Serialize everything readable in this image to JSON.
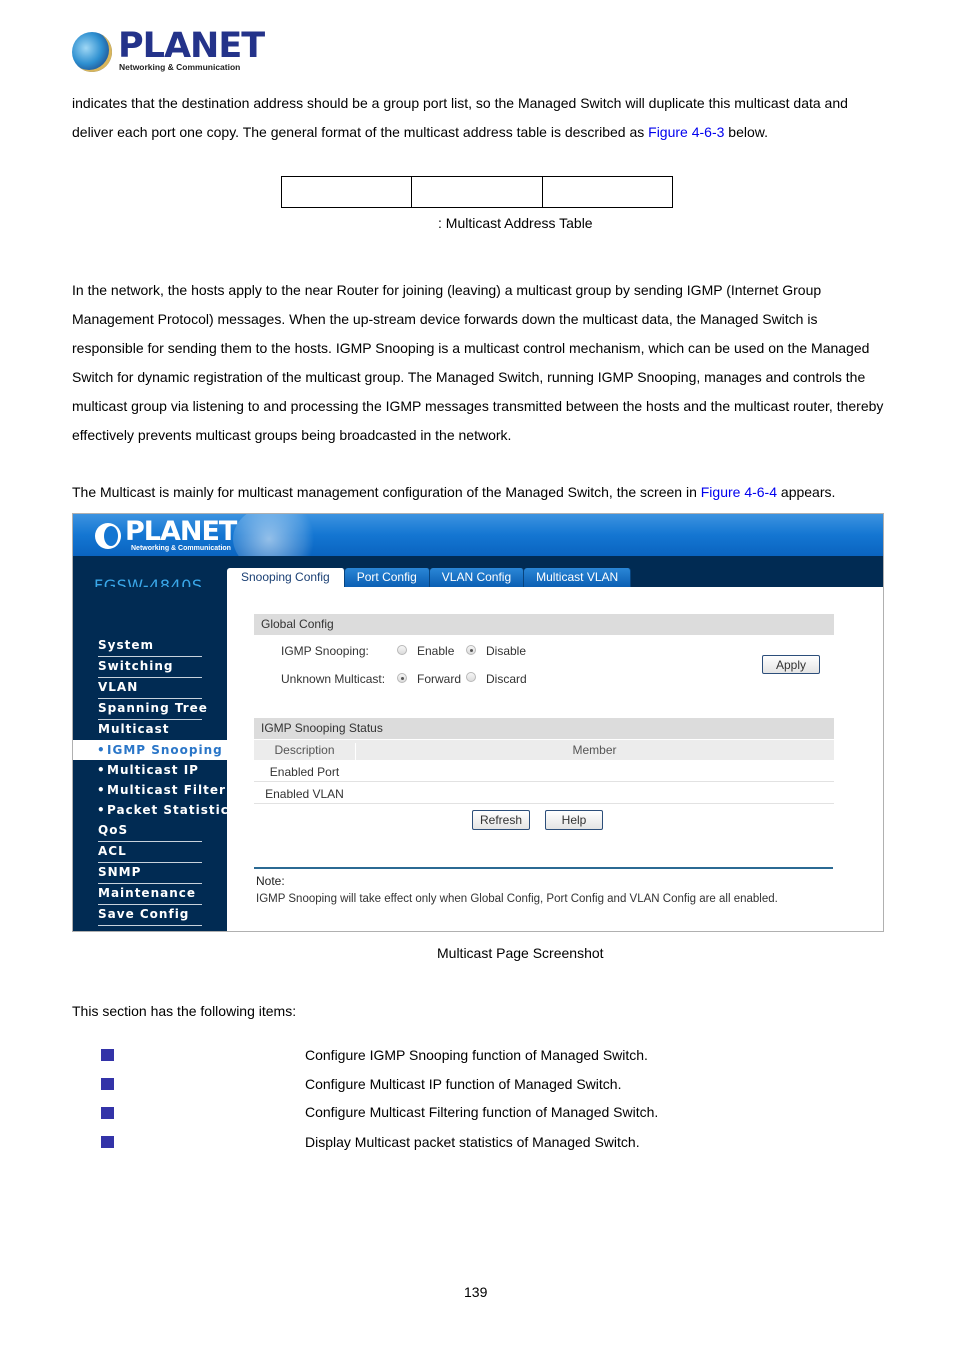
{
  "header_logo": {
    "brand": "PLANET",
    "tagline": "Networking & Communication",
    "icon": "planet-globe-logo"
  },
  "intro": {
    "line1": "indicates that the destination address should be a group port list, so the Managed Switch will duplicate this multicast data and",
    "line2_pre": "deliver each port one copy. The general format of the multicast address table is described as ",
    "line2_link": "Figure 4-6-3",
    "line2_post": " below."
  },
  "address_table": {
    "columns": [
      "",
      "",
      ""
    ],
    "caption": ": Multicast Address Table"
  },
  "igmp_paragraph": [
    "In the network, the hosts apply to the near Router for joining (leaving) a multicast group by sending IGMP (Internet Group",
    "Management Protocol) messages. When the up-stream device forwards down the multicast data, the Managed Switch is",
    "responsible for sending them to the hosts. IGMP Snooping is a multicast control mechanism, which can be used on the Managed",
    "Switch for dynamic registration of the multicast group. The Managed Switch, running IGMP Snooping, manages and controls the",
    "multicast group via listening to and processing the IGMP messages transmitted between the hosts and the multicast router, thereby",
    "effectively prevents multicast groups being broadcasted in the network."
  ],
  "screen_intro": {
    "pre": "The Multicast is mainly for multicast management configuration of the Managed Switch, the screen in ",
    "link": "Figure 4-6-4",
    "post": " appears."
  },
  "screenshot": {
    "banner_brand": "PLANET",
    "banner_tagline": "Networking & Communication",
    "model": "FGSW-4840S",
    "tabs": [
      {
        "label": "Snooping Config",
        "active": true
      },
      {
        "label": "Port Config",
        "active": false
      },
      {
        "label": "VLAN Config",
        "active": false
      },
      {
        "label": "Multicast VLAN",
        "active": false
      }
    ],
    "sidebar": [
      {
        "label": "System"
      },
      {
        "label": "Switching"
      },
      {
        "label": "VLAN"
      },
      {
        "label": "Spanning Tree"
      },
      {
        "label": "Multicast"
      },
      {
        "label": "IGMP Snooping",
        "sub": true,
        "active": true
      },
      {
        "label": "Multicast IP",
        "sub": true
      },
      {
        "label": "Multicast Filter",
        "sub": true
      },
      {
        "label": "Packet Statistics",
        "sub": true
      },
      {
        "label": "QoS"
      },
      {
        "label": "ACL"
      },
      {
        "label": "SNMP"
      },
      {
        "label": "Maintenance"
      },
      {
        "label": "Save Config"
      }
    ],
    "sub_bullet": "•",
    "global_config": {
      "title": "Global Config",
      "igmp_label": "IGMP Snooping:",
      "igmp_options": [
        "Enable",
        "Disable"
      ],
      "igmp_selected": "Disable",
      "unknown_label": "Unknown Multicast:",
      "unknown_options": [
        "Forward",
        "Discard"
      ],
      "unknown_selected": "Forward",
      "apply_label": "Apply"
    },
    "status": {
      "title": "IGMP Snooping Status",
      "columns": [
        "Description",
        "Member"
      ],
      "rows": [
        {
          "description": "Enabled Port",
          "member": ""
        },
        {
          "description": "Enabled VLAN",
          "member": ""
        }
      ],
      "refresh_label": "Refresh",
      "help_label": "Help"
    },
    "note": {
      "title": "Note:",
      "text": "IGMP Snooping will take effect only when Global Config, Port Config and VLAN Config are all enabled."
    }
  },
  "screenshot_caption": "Multicast Page Screenshot",
  "items_intro": "This section has the following items:",
  "items": [
    {
      "name": "",
      "description": "Configure IGMP Snooping function of Managed Switch."
    },
    {
      "name": "",
      "description": "Configure Multicast IP function of Managed Switch."
    },
    {
      "name": "",
      "description": "Configure Multicast Filtering function of Managed Switch."
    },
    {
      "name": "",
      "description": "Display Multicast packet statistics of Managed Switch."
    }
  ],
  "colors": {
    "bullet": "#3333a8",
    "link": "#0000ee",
    "nav_dark": "#012b53",
    "banner_blue": "#1476d2",
    "model_text": "#3aa8ea"
  },
  "page_number": "139"
}
